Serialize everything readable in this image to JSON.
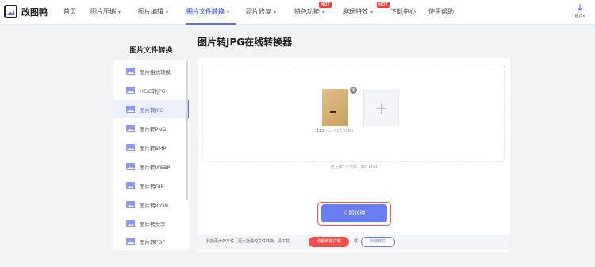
{
  "app": {
    "name": "改图鸭",
    "logo_icon": "image-icon"
  },
  "nav": {
    "items": [
      {
        "label": "首页",
        "has_caret": false
      },
      {
        "label": "图片压缩",
        "has_caret": true
      },
      {
        "label": "图片编辑",
        "has_caret": true
      },
      {
        "label": "图片文件转换",
        "has_caret": true,
        "active": true
      },
      {
        "label": "照片修复",
        "has_caret": true
      },
      {
        "label": "特色功能",
        "has_caret": true,
        "badge": "HOT"
      },
      {
        "label": "趣玩特效",
        "has_caret": true,
        "badge": "HOT"
      },
      {
        "label": "下载中心",
        "has_caret": false
      },
      {
        "label": "使用帮助",
        "has_caret": false
      }
    ],
    "caret": "▾",
    "account_label": "账户ıı",
    "account_icon": "download-icon"
  },
  "sidebar": {
    "title": "图片文件转换",
    "items": [
      {
        "label": "图片格式转换"
      },
      {
        "label": "HEIC转JPG"
      },
      {
        "label": "图片转JPG",
        "active": true
      },
      {
        "label": "图片转PNG"
      },
      {
        "label": "图片转BMP"
      },
      {
        "label": "图片转WEBP"
      },
      {
        "label": "图片转GIF"
      },
      {
        "label": "图片转ICON"
      },
      {
        "label": "图片转文字"
      },
      {
        "label": "图片转PDF"
      }
    ]
  },
  "main": {
    "title": "图片转JPG在线转换器",
    "file": {
      "name": "123 - ...",
      "size": "617.98KB"
    },
    "remove_glyph": "×",
    "add_glyph": "+",
    "upload_count": "已上传1个文件，共0.60M",
    "convert_label": "立即转换",
    "bottom_note": "转换更大的文件、更大批量的文件转换，请下载",
    "download_client_label": "改图鸭客户端",
    "or_text": "或",
    "upgrade_label": "升级账户"
  },
  "colors": {
    "accent": "#5b6ff2",
    "button": "#6a7cf5",
    "highlight": "#f0504b",
    "hot_badge": "#f23b3b"
  }
}
